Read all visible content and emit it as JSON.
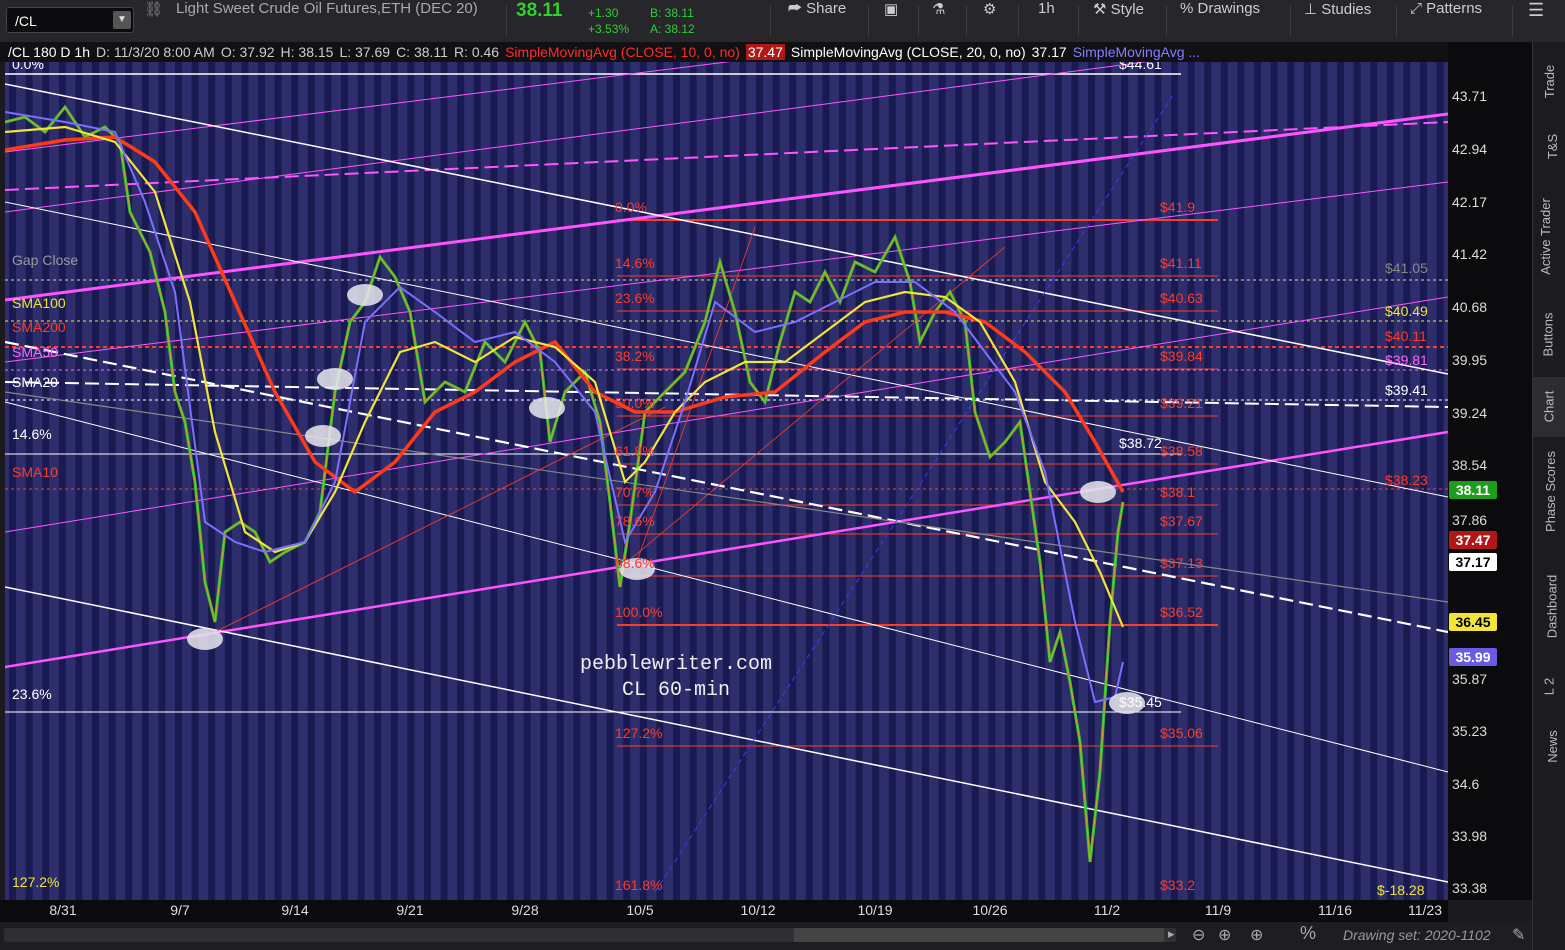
{
  "toolbar": {
    "symbol": "/CL",
    "instrument": "Light Sweet Crude Oil Futures,ETH (DEC 20)",
    "last": "38.11",
    "change_abs": "+1.30",
    "change_pct": "+3.53%",
    "bid": "B: 38.11",
    "ask": "A: 38.12",
    "share": "Share",
    "interval": "1h",
    "style": "Style",
    "drawings": "Drawings",
    "studies": "Studies",
    "patterns": "Patterns"
  },
  "infobar": {
    "name": "/CL 180 D 1h",
    "date": "D: 11/3/20 8:00 AM",
    "open": "O: 37.92",
    "high": "H: 38.15",
    "low": "L: 37.69",
    "close": "C: 38.11",
    "range": "R: 0.46",
    "sma10_label": "SimpleMovingAvg (CLOSE, 10, 0, no)",
    "sma10_value": "37.47",
    "sma20_label": "SimpleMovingAvg (CLOSE, 20, 0, no)",
    "sma20_value": "37.17",
    "sma3_label": "SimpleMovingAvg ..."
  },
  "price_axis": [
    "43.71",
    "42.94",
    "42.17",
    "41.42",
    "40.68",
    "39.95",
    "39.24",
    "38.54",
    "37.86",
    "35.87",
    "35.23",
    "34.6",
    "33.98",
    "33.38"
  ],
  "price_tags": [
    {
      "text": "38.11",
      "bg": "#1f9d1f",
      "fg": "#ffffff"
    },
    {
      "text": "37.47",
      "bg": "#b01818",
      "fg": "#ffffff"
    },
    {
      "text": "37.17",
      "bg": "#ffffff",
      "fg": "#000000"
    },
    {
      "text": "36.45",
      "bg": "#f1e43a",
      "fg": "#000000"
    },
    {
      "text": "35.99",
      "bg": "#6a5be0",
      "fg": "#ffffff"
    }
  ],
  "x_axis": [
    "8/31",
    "9/7",
    "9/14",
    "9/21",
    "9/28",
    "10/5",
    "10/12",
    "10/19",
    "10/26",
    "11/2",
    "11/9",
    "11/16",
    "11/23"
  ],
  "left_labels": [
    {
      "text": "0.0%",
      "color": "#ffffff"
    },
    {
      "text": "Gap Close",
      "color": "#9a9a9a"
    },
    {
      "text": "SMA100",
      "color": "#f1e43a"
    },
    {
      "text": "SMA200",
      "color": "#ff3b2a"
    },
    {
      "text": "SMA50",
      "color": "#ff66ff"
    },
    {
      "text": "SMA20",
      "color": "#ffffff"
    },
    {
      "text": "14.6%",
      "color": "#ffffff"
    },
    {
      "text": "SMA10",
      "color": "#ff3b2a"
    },
    {
      "text": "23.6%",
      "color": "#ffffff"
    },
    {
      "text": "127.2%",
      "color": "#f1e43a"
    }
  ],
  "fib_levels": [
    {
      "pct": "0.0%",
      "price": "$41.9"
    },
    {
      "pct": "14.6%",
      "price": "$41.11"
    },
    {
      "pct": "23.6%",
      "price": "$40.63"
    },
    {
      "pct": "38.2%",
      "price": "$39.84"
    },
    {
      "pct": "50.0%",
      "price": "$39.21"
    },
    {
      "pct": "61.8%",
      "price": "$38.58"
    },
    {
      "pct": "70.7%",
      "price": "$38.1"
    },
    {
      "pct": "78.6%",
      "price": "$37.67"
    },
    {
      "pct": "88.6%",
      "price": "$37.13"
    },
    {
      "pct": "100.0%",
      "price": "$36.52"
    },
    {
      "pct": "127.2%",
      "price": "$35.06"
    },
    {
      "pct": "161.8%",
      "price": "$33.2"
    }
  ],
  "right_labels": [
    {
      "text": "$44.61",
      "color": "#ffffff"
    },
    {
      "text": "$41.05",
      "color": "#888888"
    },
    {
      "text": "$40.49",
      "color": "#f1e43a"
    },
    {
      "text": "$40.11",
      "color": "#ff3b2a"
    },
    {
      "text": "$39.81",
      "color": "#ff66ff"
    },
    {
      "text": "$39.41",
      "color": "#ffffff"
    },
    {
      "text": "$38.72",
      "color": "#ffffff"
    },
    {
      "text": "$38.23",
      "color": "#ff3b2a"
    },
    {
      "text": "$35.45",
      "color": "#ffffff"
    },
    {
      "text": "$-18.28",
      "color": "#f1e43a"
    }
  ],
  "watermark": {
    "line1": "pebblewriter.com",
    "line2": "CL 60-min"
  },
  "sidebar": [
    "Trade",
    "T&S",
    "Active Trader",
    "Buttons",
    "Chart",
    "Phase Scores",
    "Dashboard",
    "L 2",
    "News"
  ],
  "footer": {
    "drawing_set": "Drawing set: 2020-1102"
  }
}
